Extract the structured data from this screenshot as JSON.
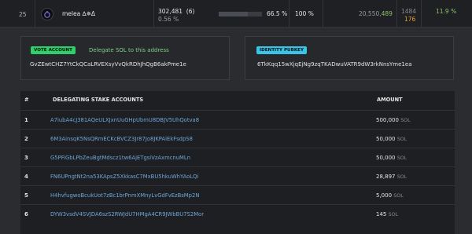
{
  "validator_row": {
    "rank": "25",
    "name": "melea ∆✵Δ",
    "stake": "302,481",
    "stake_rank": "(6)",
    "stake_percent": "0.56 %",
    "cumulative_stake_percent": "66.5 %",
    "cumulative_fraction": 0.665,
    "commission": "100 %",
    "credits_prefix": "20,550,",
    "credits_highlight": "489",
    "vote_distance_top": "1484",
    "vote_distance_bottom": "176",
    "apy": "11.9 %"
  },
  "vote_account": {
    "badge": "VOTE ACCOUNT",
    "delegate_link": "Delegate SOL to this address",
    "address": "GvZEwtCHZ7YtCkQCaLRVEXsyVvQkRDhJhQgB6akPme1e"
  },
  "identity": {
    "badge": "IDENTITY PUBKEY",
    "address": "6TkKqq15wXjqEjNg9zqTKADwuVATR9dW3rkNnsYme1ea"
  },
  "table": {
    "headers": {
      "num": "#",
      "account": "DELEGATING STAKE ACCOUNTS",
      "amount": "AMOUNT"
    },
    "unit": "SOL",
    "rows": [
      {
        "num": "1",
        "account": "A7iubA4cJ381AQeULXJxnUuGHpUbmU8DBJV5UhQotva8",
        "amount": "500,000"
      },
      {
        "num": "2",
        "account": "6M3AinsqK5NsQRmECKcBVCZ3Jr87Jo8JKPAiEkFsdpS8",
        "amount": "50,000"
      },
      {
        "num": "3",
        "account": "G5PFiGbLPbZeuBgtMdscz1tw6AjETgsiVzAxmcnuMLn",
        "amount": "50,000"
      },
      {
        "num": "4",
        "account": "FN6UPngtNt2na53KApsZ5XkkasC7MxBU5hkuWhYAoLQi",
        "amount": "28,897"
      },
      {
        "num": "5",
        "account": "H4hvfugwoBcukUot7zBc1brPnmXMnyLvGdFvEzBsMp2N",
        "amount": "5,000"
      },
      {
        "num": "6",
        "account": "DYW3vsdV4SVJDA6szS2RWJdU7HMgA4CR9JWbBU7S2Mor",
        "amount": "145"
      }
    ]
  },
  "colors": {
    "background": "#2b2c30",
    "link": "#6fa6d8",
    "positive": "#8fc16b",
    "warning": "#e8a035"
  }
}
